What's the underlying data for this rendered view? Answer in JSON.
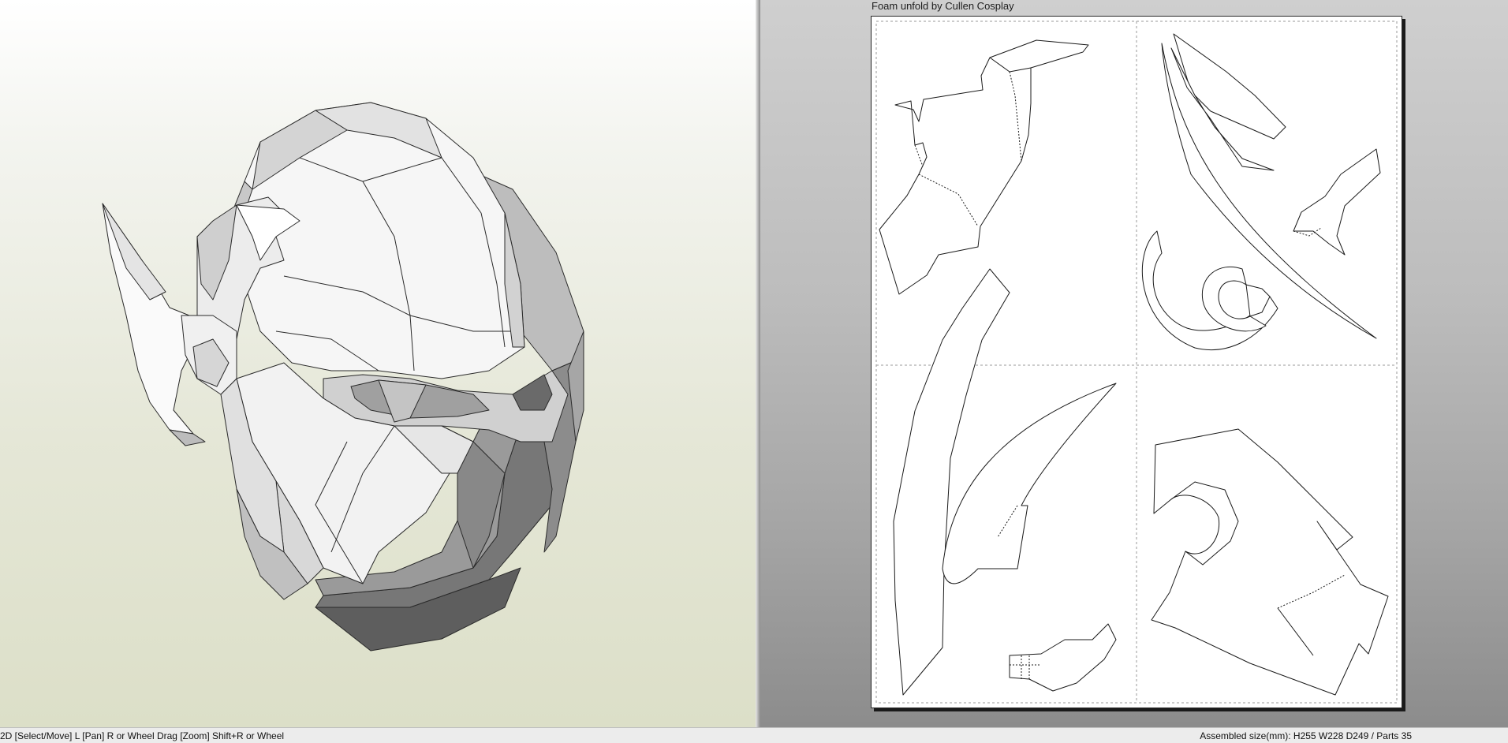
{
  "view2d": {
    "credit": "Foam unfold by Cullen Cosplay"
  },
  "statusbar": {
    "hint": "2D [Select/Move] L [Pan] R or Wheel Drag [Zoom] Shift+R or Wheel",
    "info": "Assembled size(mm): H255 W228 D249 / Parts 35"
  },
  "colors": {
    "paper": "#ffffff",
    "line": "#1a1a1a",
    "shade_dark": "#6e6e6e",
    "shade_mid": "#a8a8a8"
  }
}
